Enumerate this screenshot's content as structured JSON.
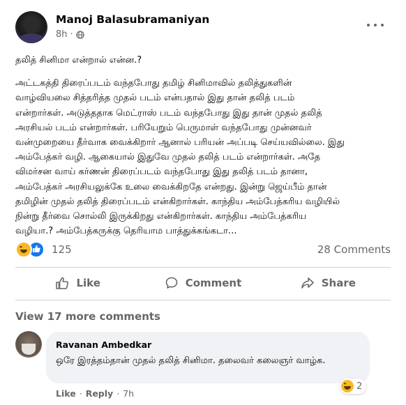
{
  "post": {
    "author": "Manoj Balasubramaniyan",
    "time": "8h",
    "dot": "·",
    "title_line": "தலித் சினிமா என்றால் என்ன.?",
    "body": "அட்டகத்தி திரைப்படம் வந்தபோது தமிழ் சினிமாவில் தலித்துகளின்\nவாழ்வியலை சித்தரித்த முதல் படம் என்பதால் இது தான் தலித் படம்\nஎன்றார்கள். அடுத்ததாக மெட்ராஸ் படம் வந்தபோது இது தான் முதல் தலித்\nஅரசியல் படம் என்றார்கள். பரியேறும் பெருமாள் வந்தபோது முன்னவர்\nவன்முறையை தீர்வாக வைக்கிறார் ஆனால் பரியன் அப்படி செய்யவில்லை. இது\nஅம்பேத்கர் வழி. ஆகையால் இதுவே முதல் தலித் படம் என்றார்கள். அதே\nவிமர்சன வாய் கர்ணன் திரைப்படம் வந்தபோது இது தலித் படம் தானா,\nஅம்பேத்கர் அரசியலுக்கே உலை வைக்கிறதே என்றது. இன்று ஜெய்பீம் தான்\nதமிழின் முதல் தலித் திரைப்படம் என்கிறார்கள். காந்திய அம்பேத்கரிய வழியில்\nநின்று தீர்வை சொல்லி இருக்கிறது என்கிறார்கள். காந்திய அம்பேத்கரிய\nவழியா.? அம்பேத்கருக்கு தெரியாம பாத்துக்கங்கடா...",
    "reaction_count": "125",
    "comments_count": "28 Comments"
  },
  "actions": {
    "like": "Like",
    "comment": "Comment",
    "share": "Share"
  },
  "comments": {
    "view_more": "View 17 more comments",
    "items": [
      {
        "author": "Ravanan Ambedkar",
        "text": "ஒரே இரத்தம்தான் முதல் தலித் சினிமா. தலைவர் கலைஞர் வாழ்க.",
        "reaction_count": "2",
        "like_label": "Like",
        "reply_label": "Reply",
        "dot": "·",
        "time": "7h"
      }
    ]
  },
  "icons": {
    "more": "more-dots-icon",
    "privacy": "globe-icon",
    "like": "thumbs-up-icon",
    "comment": "comment-bubble-icon",
    "share": "share-arrow-icon",
    "reaction_haha": "haha-reaction-icon",
    "reaction_like": "like-reaction-icon"
  },
  "colors": {
    "secondary_text": "#65676b",
    "like_blue": "#1877f2",
    "haha_yellow": "#f7b928",
    "comment_bg": "#f0f2f5"
  }
}
